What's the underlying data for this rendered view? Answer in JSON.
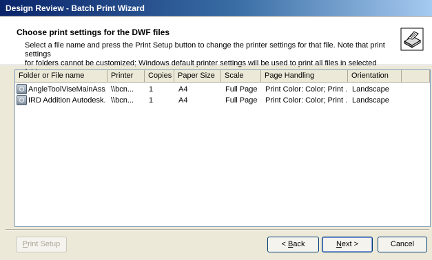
{
  "window": {
    "title": "Design Review - Batch Print Wizard"
  },
  "header": {
    "title": "Choose print settings for the DWF files",
    "desc_line1": "Select a file name and press the Print Setup button to change the printer settings for that file. Note that print settings",
    "desc_line2": "for folders cannot be customized; Windows default printer settings will be used to print all files in selected folders.",
    "icon": "printer-icon"
  },
  "list": {
    "columns": [
      "Folder or File name",
      "Printer",
      "Copies",
      "Paper Size",
      "Scale",
      "Page Handling",
      "Orientation"
    ],
    "rows": [
      {
        "name": "AngleToolViseMainAss...",
        "printer": "\\\\bcn...",
        "copies": "1",
        "paper": "A4",
        "scale": "Full Page",
        "handling": "Print Color: Color; Print ...",
        "orientation": "Landscape",
        "icon": "dwf-file-icon"
      },
      {
        "name": "IRD Addition Autodesk...",
        "printer": "\\\\bcn...",
        "copies": "1",
        "paper": "A4",
        "scale": "Full Page",
        "handling": "Print Color: Color; Print ...",
        "orientation": "Landscape",
        "icon": "dwf-file-icon"
      }
    ]
  },
  "buttons": {
    "print_setup_accel": "P",
    "print_setup_rest": "rint Setup",
    "back_prefix": "< ",
    "back_accel": "B",
    "back_rest": "ack",
    "next_accel": "N",
    "next_rest": "ext >",
    "cancel": "Cancel"
  }
}
